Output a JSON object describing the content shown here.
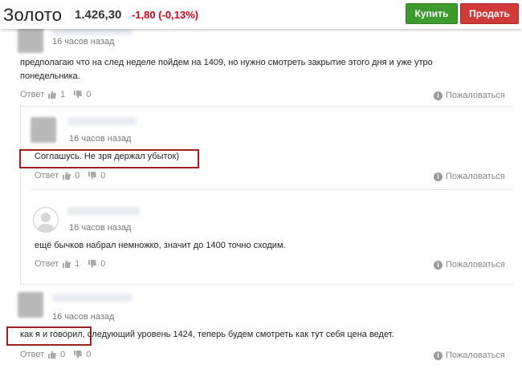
{
  "header": {
    "title": "Золото",
    "price": "1.426,30",
    "change": "-1,80 (-0,13%)",
    "buy_label": "Купить",
    "sell_label": "Продать",
    "colors": {
      "buy": "#3d9a2c",
      "sell": "#d03a3a",
      "change": "#d0021b"
    }
  },
  "comments": [
    {
      "time": "16 часов назад",
      "text_line1": "предполагаю что на след неделе пойдем на 1409, но нужно смотреть закрытие этого дня и уже утро",
      "text_line2": "понедельника.",
      "reply_label": "Ответ",
      "likes": "1",
      "dislikes": "0",
      "report_label": "Пожаловаться"
    },
    {
      "time": "16 часов назад",
      "text": "Соглашусь. Не зря держал убыток)",
      "reply_label": "Ответ",
      "likes": "0",
      "dislikes": "0",
      "report_label": "Пожаловаться"
    },
    {
      "time": "16 часов назад",
      "text": "ещё бычков набрал немножко, значит до 1400 точно сходим.",
      "reply_label": "Ответ",
      "likes": "1",
      "dislikes": "0",
      "report_label": "Пожаловаться"
    },
    {
      "time": "16 часов назад",
      "text_highlight": "как я и говорил,",
      "text_rest": " следующий уровень 1424, теперь будем смотреть как тут себя цена ведет.",
      "reply_label": "Ответ",
      "likes": "0",
      "dislikes": "0",
      "report_label": "Пожаловаться"
    }
  ]
}
